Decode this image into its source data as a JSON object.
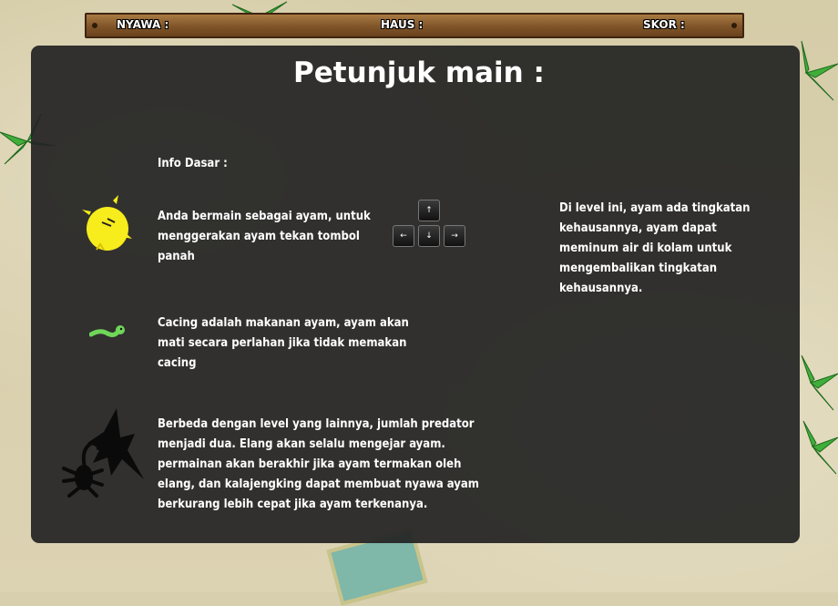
{
  "hud": {
    "lives_label": "NYAWA :",
    "thirst_label": "HAUS :",
    "score_label": "SKOR :"
  },
  "panel": {
    "title": "Petunjuk main :",
    "basic_info_label": "Info Dasar :",
    "chicken_instruction": "Anda  bermain sebagai ayam, untuk menggerakan ayam tekan tombol panah",
    "worm_instruction": "Cacing adalah makanan ayam, ayam akan mati secara perlahan jika tidak memakan cacing",
    "predator_instruction": "Berbeda dengan level yang lainnya, jumlah predator menjadi dua. Elang akan selalu mengejar ayam. permainan akan berakhir jika ayam termakan oleh elang,  dan kalajengking dapat membuat nyawa ayam berkurang lebih cepat jika ayam terkenanya.",
    "thirst_instruction": "Di level ini, ayam ada tingkatan kehausannya, ayam dapat meminum air di kolam untuk mengembalikan tingkatan kehausannya.",
    "arrow_keys": {
      "up": "↑",
      "left": "←",
      "down": "↓",
      "right": "→"
    }
  },
  "icons": {
    "chicken": "chicken-icon",
    "worm": "worm-icon",
    "eagle": "eagle-icon",
    "scorpion": "scorpion-icon"
  },
  "colors": {
    "panel": "#242424",
    "hud_wood": "#7f5428",
    "chicken": "#f7ec1c",
    "worm": "#6fd65a"
  }
}
